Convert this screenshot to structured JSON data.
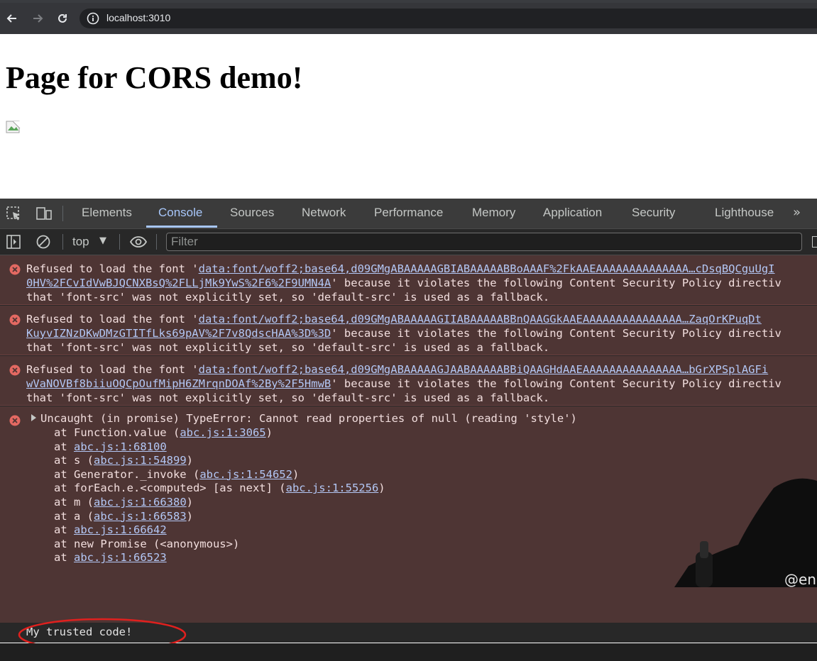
{
  "browser": {
    "url": "localhost:3010"
  },
  "page": {
    "heading": "Page for CORS demo!"
  },
  "devtools": {
    "tabs": [
      {
        "label": "Elements"
      },
      {
        "label": "Console"
      },
      {
        "label": "Sources"
      },
      {
        "label": "Network"
      },
      {
        "label": "Performance"
      },
      {
        "label": "Memory"
      },
      {
        "label": "Application"
      },
      {
        "label": "Security"
      },
      {
        "label": "Lighthouse"
      }
    ],
    "active_tab": "Console",
    "console_toolbar": {
      "context": "top",
      "filter_placeholder": "Filter"
    },
    "messages": [
      {
        "pre": "Refused to load the font '",
        "link1": "data:font/woff2;base64,d09GMgABAAAAAGBIABAAAAABBoAAAF%2FkAAEAAAAAAAAAAAAAA…cDsqBQCguUgI",
        "link2": "0HV%2FCvIdVwBJQCNXBsQ%2FLLjMk9YwS%2F6%2F9UMN4A",
        "post": "' because it violates the following Content Security Policy directiv",
        "line3": "that 'font-src' was not explicitly set, so 'default-src' is used as a fallback."
      },
      {
        "pre": "Refused to load the font '",
        "link1": "data:font/woff2;base64,d09GMgABAAAAAGIIABAAAAABBnQAAGGkAAEAAAAAAAAAAAAAAA…ZaqOrKPuqDt",
        "link2": "KuyvIZNzDKwDMzGTITfLks69pAV%2F7v8QdscHAA%3D%3D",
        "post": "' because it violates the following Content Security Policy directiv",
        "line3": "that 'font-src' was not explicitly set, so 'default-src' is used as a fallback."
      },
      {
        "pre": "Refused to load the font '",
        "link1": "data:font/woff2;base64,d09GMgABAAAAAGJAABAAAAABBiQAAGHdAAEAAAAAAAAAAAAAAA…bGrXPSplAGFi",
        "link2": "wVaNOVBf8biiuOQCpOufMipH6ZMrqnDOAf%2By%2F5HmwB",
        "post": "' because it violates the following Content Security Policy directiv",
        "line3": "that 'font-src' was not explicitly set, so 'default-src' is used as a fallback."
      }
    ],
    "error": {
      "summary": "Uncaught (in promise) TypeError: Cannot read properties of null (reading 'style')",
      "stack": [
        {
          "pre": "at Function.value (",
          "link": "abc.js:1:3065",
          "post": ")"
        },
        {
          "pre": "at ",
          "link": "abc.js:1:68100",
          "post": ""
        },
        {
          "pre": "at s (",
          "link": "abc.js:1:54899",
          "post": ")"
        },
        {
          "pre": "at Generator._invoke (",
          "link": "abc.js:1:54652",
          "post": ")"
        },
        {
          "pre": "at forEach.e.<computed> [as next] (",
          "link": "abc.js:1:55256",
          "post": ")"
        },
        {
          "pre": "at m (",
          "link": "abc.js:1:66380",
          "post": ")"
        },
        {
          "pre": "at a (",
          "link": "abc.js:1:66583",
          "post": ")"
        },
        {
          "pre": "at ",
          "link": "abc.js:1:66642",
          "post": ""
        },
        {
          "pre": "at new Promise (<anonymous>)",
          "link": "",
          "post": ""
        },
        {
          "pre": "at ",
          "link": "abc.js:1:66523",
          "post": ""
        }
      ]
    },
    "log": "My trusted code!"
  },
  "colors": {
    "error_bg": "#4e3534",
    "link": "#b3c7f5",
    "active_tab": "#a8c7fa",
    "annotation": "#e0201e"
  }
}
